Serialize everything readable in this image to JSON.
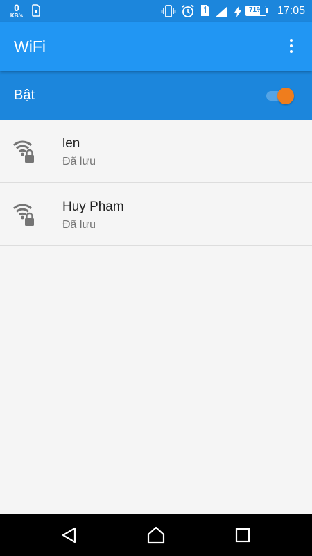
{
  "status_bar": {
    "net_speed_value": "0",
    "net_speed_unit": "KB/s",
    "battery_percent": "71%",
    "battery_level": 0.71,
    "time": "17:05",
    "icons": [
      "sim-card-icon",
      "vibrate-icon",
      "alarm-icon",
      "sim-1-icon",
      "signal-icon",
      "charging-icon",
      "battery-icon"
    ]
  },
  "app_bar": {
    "title": "WiFi",
    "menu_icon": "more-vert-icon"
  },
  "wifi_toggle": {
    "label": "Bật",
    "state": "on",
    "thumb_color": "#ef7d1d"
  },
  "networks": [
    {
      "name": "len",
      "status": "Đã lưu",
      "icon": "wifi-lock-icon"
    },
    {
      "name": "Huy Pham",
      "status": "Đã lưu",
      "icon": "wifi-lock-icon"
    }
  ],
  "nav_bar": {
    "buttons": [
      "back-icon",
      "home-icon",
      "recents-icon"
    ]
  },
  "colors": {
    "status_bar": "#1c86dc",
    "app_bar": "#2196f3",
    "accent": "#ef7d1d",
    "background": "#f5f5f5"
  }
}
